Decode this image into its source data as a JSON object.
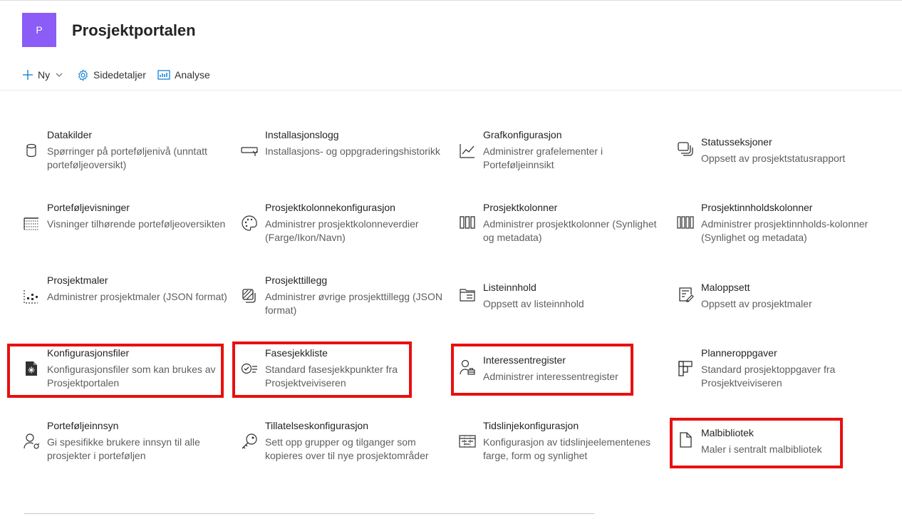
{
  "site": {
    "logo_letter": "P",
    "title": "Prosjektportalen",
    "accent": "#8b5cf6"
  },
  "commandbar": {
    "new_label": "Ny",
    "details_label": "Sidedetaljer",
    "analytics_label": "Analyse"
  },
  "tiles": [
    {
      "title": "Datakilder",
      "desc": "Spørringer på porteføljenivå (unntatt porteføljeoversikt)",
      "icon": "database-icon"
    },
    {
      "title": "Installasjonslogg",
      "desc": "Installasjons- og oppgraderingshistorikk",
      "icon": "install-icon"
    },
    {
      "title": "Grafkonfigurasjon",
      "desc": "Administrer grafelementer i Porteføljeinnsikt",
      "icon": "chart-icon"
    },
    {
      "title": "Statusseksjoner",
      "desc": "Oppsett av prosjektstatusrapport",
      "icon": "sections-icon"
    },
    {
      "title": "Porteføljevisninger",
      "desc": "Visninger tilhørende porteføljeoversikten",
      "icon": "table-icon"
    },
    {
      "title": "Prosjektkolonnekonfigurasjon",
      "desc": "Administrer prosjektkolonneverdier (Farge/Ikon/Navn)",
      "icon": "palette-icon"
    },
    {
      "title": "Prosjektkolonner",
      "desc": "Administrer prosjektkolonner (Synlighet og metadata)",
      "icon": "columns-icon"
    },
    {
      "title": "Prosjektinnholdskolonner",
      "desc": "Administrer prosjektinnholds-kolonner (Synlighet og metadata)",
      "icon": "content-columns-icon"
    },
    {
      "title": "Prosjektmaler",
      "desc": "Administrer prosjektmaler (JSON format)",
      "icon": "template-icon"
    },
    {
      "title": "Prosjekttillegg",
      "desc": "Administrer øvrige prosjekttillegg (JSON format)",
      "icon": "addon-icon"
    },
    {
      "title": "Listeinnhold",
      "desc": "Oppsett av listeinnhold",
      "icon": "folder-list-icon"
    },
    {
      "title": "Maloppsett",
      "desc": "Oppsett av prosjektmaler",
      "icon": "form-icon"
    },
    {
      "title": "Konfigurasjonsfiler",
      "desc": "Konfigurasjonsfiler som kan brukes av Prosjektportalen",
      "icon": "config-file-icon"
    },
    {
      "title": "Fasesjekkliste",
      "desc": "Standard fasesjekkpunkter fra Prosjektveiviseren",
      "icon": "checklist-icon"
    },
    {
      "title": "Interessentregister",
      "desc": "Administrer interessentregister",
      "icon": "stakeholder-icon"
    },
    {
      "title": "Planneroppgaver",
      "desc": "Standard prosjektoppgaver fra Prosjektveiviseren",
      "icon": "planner-icon"
    },
    {
      "title": "Porteføljeinnsyn",
      "desc": "Gi spesifikke brukere innsyn til alle prosjekter i porteføljen",
      "icon": "user-access-icon"
    },
    {
      "title": "Tillatelseskonfigurasjon",
      "desc": "Sett opp grupper og tilganger som kopieres over til nye prosjektområder",
      "icon": "key-icon"
    },
    {
      "title": "Tidslinjekonfigurasjon",
      "desc": "Konfigurasjon av tidslinjeelementenes farge, form og synlighet",
      "icon": "timeline-icon"
    },
    {
      "title": "Malbibliotek",
      "desc": "Maler i sentralt malbibliotek",
      "icon": "document-icon"
    }
  ],
  "highlight_color": "#e81010"
}
